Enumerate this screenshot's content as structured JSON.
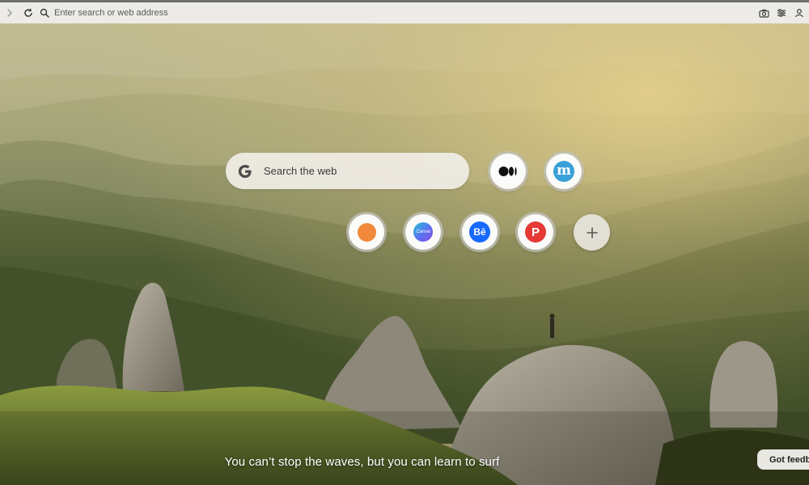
{
  "toolbar": {
    "address_placeholder": "Enter search or web address",
    "icons": [
      "chevron-right-icon",
      "reload-icon",
      "search-icon",
      "camera-icon",
      "sliders-icon",
      "profile-icon"
    ]
  },
  "search": {
    "placeholder": "Search the web",
    "engine_icon": "google-g-icon"
  },
  "shortcuts": {
    "row1": [
      {
        "name": "medium",
        "icon": "medium-icon"
      },
      {
        "name": "mastodon",
        "icon": "mastodon-m-icon",
        "glyph": "m"
      }
    ],
    "row2": [
      {
        "name": "orange",
        "icon": "orange-dot-icon",
        "color": "#f08a3a"
      },
      {
        "name": "canva",
        "icon": "canva-icon",
        "glyph": "Canva"
      },
      {
        "name": "behance",
        "icon": "behance-icon",
        "glyph": "Bē"
      },
      {
        "name": "pinterest",
        "icon": "p-icon",
        "glyph": "P"
      }
    ],
    "add_glyph": "+"
  },
  "quote": {
    "text": "You can’t stop the waves, but you can learn to surf"
  },
  "feedback": {
    "label": "Got feedback?"
  },
  "colors": {
    "toolbar_bg": "#ecebe8",
    "behance_blue": "#1769ff",
    "pinterest_red": "#e53935",
    "mastodon_blue": "#3aa0d8",
    "orange": "#f08a3a"
  }
}
